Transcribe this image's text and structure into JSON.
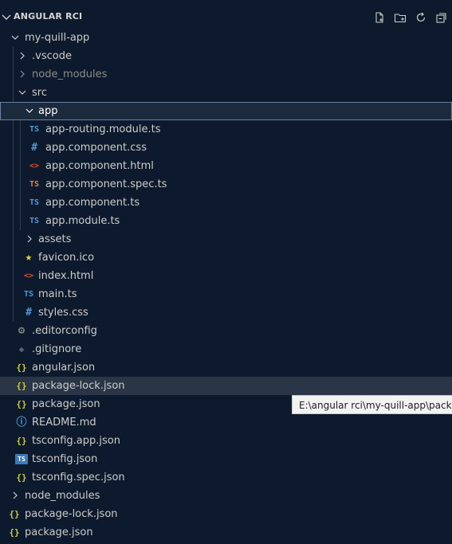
{
  "colors": {
    "background": "#0d1a2d",
    "ts": "#4f9ad6",
    "css": "#4f9ad6",
    "html": "#e44d26",
    "spec": "#f07a3a",
    "json": "#cbcb41",
    "star": "#f0d443",
    "gear": "#9a9a9a"
  },
  "header": {
    "title": "ANGULAR RCI",
    "actions": [
      "new-file-icon",
      "new-folder-icon",
      "refresh-icon",
      "collapse-all-icon"
    ]
  },
  "tree": {
    "root_folder": "my-quill-app",
    "vscode_folder": ".vscode",
    "node_modules_inner": "node_modules",
    "src_folder": "src",
    "app_folder": "app",
    "app_files": [
      {
        "name": "app-routing.module.ts",
        "badge": "TS"
      },
      {
        "name": "app.component.css",
        "badge": "#"
      },
      {
        "name": "app.component.html",
        "badge": "<>"
      },
      {
        "name": "app.component.spec.ts",
        "badge": "TS"
      },
      {
        "name": "app.component.ts",
        "badge": "TS"
      },
      {
        "name": "app.module.ts",
        "badge": "TS"
      }
    ],
    "assets_folder": "assets",
    "src_files": [
      {
        "name": "favicon.ico",
        "badge": "★"
      },
      {
        "name": "index.html",
        "badge": "<>"
      },
      {
        "name": "main.ts",
        "badge": "TS"
      },
      {
        "name": "styles.css",
        "badge": "#"
      }
    ],
    "root_files": [
      {
        "name": ".editorconfig",
        "badge": "⚙"
      },
      {
        "name": ".gitignore",
        "badge": "◆"
      },
      {
        "name": "angular.json",
        "badge": "{}"
      },
      {
        "name": "package-lock.json",
        "badge": "{}"
      },
      {
        "name": "package.json",
        "badge": "{}"
      },
      {
        "name": "README.md",
        "badge": "ⓘ"
      },
      {
        "name": "tsconfig.app.json",
        "badge": "{}"
      },
      {
        "name": "tsconfig.json",
        "badge": "TS"
      },
      {
        "name": "tsconfig.spec.json",
        "badge": "{}"
      }
    ],
    "outer_node_modules": "node_modules",
    "outer_files": [
      {
        "name": "package-lock.json",
        "badge": "{}"
      },
      {
        "name": "package.json",
        "badge": "{}"
      }
    ]
  },
  "tooltip": {
    "text": "E:\\angular rci\\my-quill-app\\package-lock.json"
  }
}
